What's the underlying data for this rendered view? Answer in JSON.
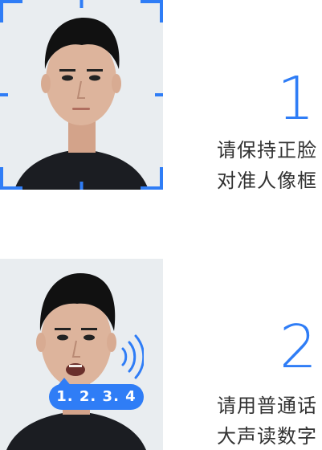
{
  "steps": [
    {
      "number": "1",
      "line1": "请保持正脸",
      "line2": "对准人像框"
    },
    {
      "number": "2",
      "line1": "请用普通话",
      "line2": "大声读数字"
    }
  ],
  "bubble": {
    "digits": "1. 2. 3. 4"
  },
  "colors": {
    "accent": "#2f7df6",
    "text": "#333333",
    "background": "#ffffff",
    "photo_bg": "#e9edf0"
  },
  "icons": {
    "face_frame": "corner-brackets",
    "sound": "sound-waves-icon"
  }
}
